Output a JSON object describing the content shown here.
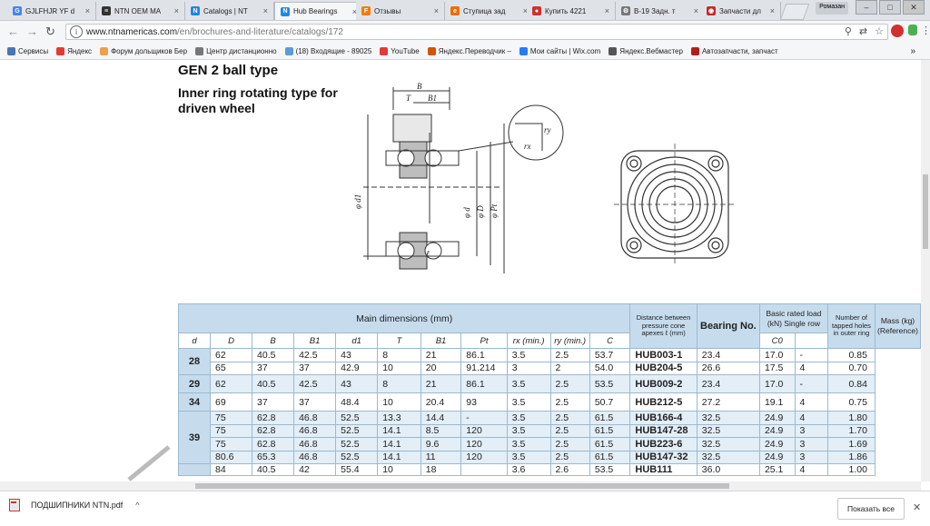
{
  "tabs": [
    {
      "label": "GJLFHJR YF d",
      "icon": "google-icon",
      "color": "#4285f4",
      "glyph": "G"
    },
    {
      "label": "NTN OEM MA",
      "icon": "ntn-icon",
      "color": "#333333",
      "glyph": "≡"
    },
    {
      "label": "Catalogs | NT",
      "icon": "n-brand-icon",
      "color": "#1e88e5",
      "glyph": "N"
    },
    {
      "label": "Hub Bearings",
      "icon": "n-brand-icon",
      "color": "#1e88e5",
      "glyph": "N",
      "active": true
    },
    {
      "label": "Отзывы",
      "icon": "f-brand-icon",
      "color": "#f57c00",
      "glyph": "F"
    },
    {
      "label": "Ступица зад",
      "icon": "e-brand-icon",
      "color": "#ef6c00",
      "glyph": "e"
    },
    {
      "label": "Купить 4221",
      "icon": "shop-icon",
      "color": "#d32f2f",
      "glyph": "●"
    },
    {
      "label": "В-19 Задн. т",
      "icon": "gear-icon",
      "color": "#777777",
      "glyph": "⚙"
    },
    {
      "label": "Запчасти дл",
      "icon": "parts-icon",
      "color": "#c62828",
      "glyph": "◉"
    }
  ],
  "window": {
    "lang_badge": "Ромазан",
    "minimize": "–",
    "maximize": "□",
    "close": "✕"
  },
  "address": {
    "host": "www.ntnamericas.com",
    "path": "/en/brochures-and-literature/catalogs/172"
  },
  "bookmarks": [
    {
      "label": "Сервисы",
      "color": "#4a76b8"
    },
    {
      "label": "Яндекс",
      "color": "#e53935"
    },
    {
      "label": "Форум дольщиков Бер",
      "color": "#f0a04b"
    },
    {
      "label": "Центр дистанционно",
      "color": "#777777"
    },
    {
      "label": "(18) Входящие - 89025",
      "color": "#5c9bd6"
    },
    {
      "label": "YouTube",
      "color": "#e53935"
    },
    {
      "label": "Яндекс.Переводчик –",
      "color": "#d35400"
    },
    {
      "label": "Мои сайты | Wix.com",
      "color": "#2979ff"
    },
    {
      "label": "Яндекс.Вебмастер",
      "color": "#555555"
    },
    {
      "label": "Автозапчасти, запчаст",
      "color": "#b71c1c"
    }
  ],
  "bookmarks_more": "»",
  "page": {
    "heading1": "GEN 2 ball type",
    "heading2": "Inner ring rotating type for driven wheel"
  },
  "diagram_labels": {
    "B": "B",
    "T": "T",
    "B1": "B1",
    "d1": "φ d1",
    "d": "φ d",
    "D": "φ D",
    "Pt": "φ Pt",
    "l": "ℓ",
    "rx": "rx",
    "ry": "ry"
  },
  "table": {
    "main_header": "Main dimensions (mm)",
    "distance_header": "Distance between pressure cone apexes ℓ (mm)",
    "bearing_header": "Bearing No.",
    "load_header": "Basic rated load (kN) Single row",
    "holes_header": "Number of tapped holes in outer ring",
    "mass_header": "Mass (kg) (Reference)",
    "sub_headers": [
      "d",
      "D",
      "B",
      "B1",
      "d1",
      "T",
      "B1",
      "Pt",
      "rx (min.)",
      "ry (min.)",
      "C",
      "C0"
    ],
    "groups": [
      {
        "d": "28",
        "shade": false,
        "rows": [
          {
            "D": "62",
            "B": "40.5",
            "B1": "42.5",
            "d1": "43",
            "T": "8",
            "B1b": "21",
            "Pt": "86.1",
            "rx": "3.5",
            "ry": "2.5",
            "l": "53.7",
            "no": "HUB003-1",
            "C": "23.4",
            "C0": "17.0",
            "holes": "-",
            "mass": "0.85"
          },
          {
            "D": "65",
            "B": "37",
            "B1": "37",
            "d1": "42.9",
            "T": "10",
            "B1b": "20",
            "Pt": "91.214",
            "rx": "3",
            "ry": "2",
            "l": "54.0",
            "no": "HUB204-5",
            "C": "26.6",
            "C0": "17.5",
            "holes": "4",
            "mass": "0.70"
          }
        ]
      },
      {
        "d": "29",
        "shade": true,
        "rows": [
          {
            "D": "62",
            "B": "40.5",
            "B1": "42.5",
            "d1": "43",
            "T": "8",
            "B1b": "21",
            "Pt": "86.1",
            "rx": "3.5",
            "ry": "2.5",
            "l": "53.5",
            "no": "HUB009-2",
            "C": "23.4",
            "C0": "17.0",
            "holes": "-",
            "mass": "0.84"
          }
        ]
      },
      {
        "d": "34",
        "shade": false,
        "rows": [
          {
            "D": "69",
            "B": "37",
            "B1": "37",
            "d1": "48.4",
            "T": "10",
            "B1b": "20.4",
            "Pt": "93",
            "rx": "3.5",
            "ry": "2.5",
            "l": "50.7",
            "no": "HUB212-5",
            "C": "27.2",
            "C0": "19.1",
            "holes": "4",
            "mass": "0.75"
          }
        ]
      },
      {
        "d": "39",
        "shade": true,
        "rows": [
          {
            "D": "75",
            "B": "62.8",
            "B1": "46.8",
            "d1": "52.5",
            "T": "13.3",
            "B1b": "14.4",
            "Pt": "-",
            "rx": "3.5",
            "ry": "2.5",
            "l": "61.5",
            "no": "HUB166-4",
            "C": "32.5",
            "C0": "24.9",
            "holes": "4",
            "mass": "1.80"
          },
          {
            "D": "75",
            "B": "62.8",
            "B1": "46.8",
            "d1": "52.5",
            "T": "14.1",
            "B1b": "8.5",
            "Pt": "120",
            "rx": "3.5",
            "ry": "2.5",
            "l": "61.5",
            "no": "HUB147-28",
            "C": "32.5",
            "C0": "24.9",
            "holes": "3",
            "mass": "1.70"
          },
          {
            "D": "75",
            "B": "62.8",
            "B1": "46.8",
            "d1": "52.5",
            "T": "14.1",
            "B1b": "9.6",
            "Pt": "120",
            "rx": "3.5",
            "ry": "2.5",
            "l": "61.5",
            "no": "HUB223-6",
            "C": "32.5",
            "C0": "24.9",
            "holes": "3",
            "mass": "1.69"
          },
          {
            "D": "80.6",
            "B": "65.3",
            "B1": "46.8",
            "d1": "52.5",
            "T": "14.1",
            "B1b": "11",
            "Pt": "120",
            "rx": "3.5",
            "ry": "2.5",
            "l": "61.5",
            "no": "HUB147-32",
            "C": "32.5",
            "C0": "24.9",
            "holes": "3",
            "mass": "1.86"
          }
        ]
      },
      {
        "d": "",
        "shade": false,
        "partial": true,
        "rows": [
          {
            "D": "84",
            "B": "40.5",
            "B1": "42",
            "d1": "55.4",
            "T": "10",
            "B1b": "18",
            "Pt": "",
            "rx": "3.6",
            "ry": "2.6",
            "l": "53.5",
            "no": "HUB111",
            "C": "36.0",
            "C0": "25.1",
            "holes": "4",
            "mass": "1.00"
          }
        ]
      }
    ]
  },
  "download": {
    "filename": "ПОДШИПНИКИ NTN.pdf",
    "show_all": "Показать все"
  }
}
